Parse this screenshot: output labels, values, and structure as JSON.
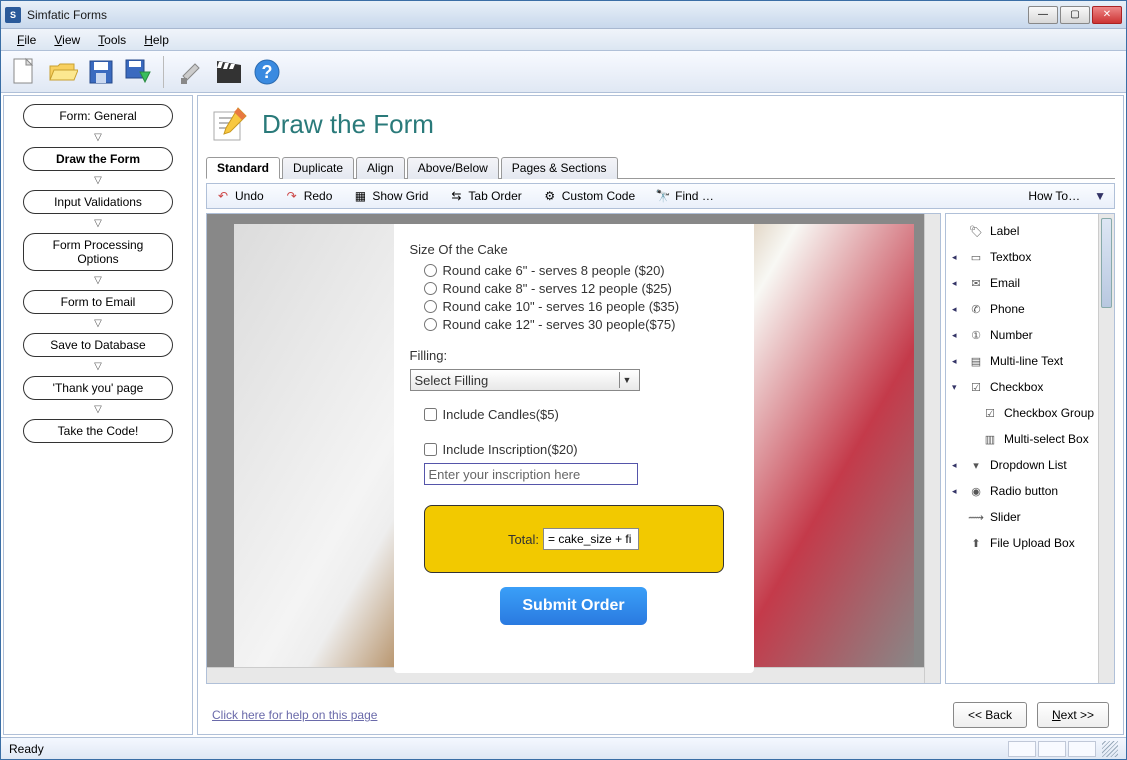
{
  "title": "Simfatic Forms",
  "menu": [
    "File",
    "View",
    "Tools",
    "Help"
  ],
  "page_title": "Draw the Form",
  "steps": [
    {
      "label": "Form: General",
      "active": false
    },
    {
      "label": "Draw the Form",
      "active": true
    },
    {
      "label": "Input Validations",
      "active": false
    },
    {
      "label": "Form Processing Options",
      "active": false
    },
    {
      "label": "Form to Email",
      "active": false
    },
    {
      "label": "Save to Database",
      "active": false
    },
    {
      "label": "'Thank you' page",
      "active": false
    },
    {
      "label": "Take the Code!",
      "active": false
    }
  ],
  "tabs": [
    "Standard",
    "Duplicate",
    "Align",
    "Above/Below",
    "Pages & Sections"
  ],
  "active_tab": "Standard",
  "editor_toolbar": {
    "undo": "Undo",
    "redo": "Redo",
    "show_grid": "Show Grid",
    "tab_order": "Tab Order",
    "custom_code": "Custom Code",
    "find": "Find …",
    "how_to": "How To…"
  },
  "form": {
    "size_label": "Size Of the Cake",
    "sizes": [
      "Round cake 6\" - serves 8 people ($20)",
      "Round cake 8\" - serves 12 people ($25)",
      "Round cake 10\" - serves 16 people ($35)",
      "Round cake 12\" - serves 30 people($75)"
    ],
    "filling_label": "Filling:",
    "filling_selected": "Select Filling",
    "candles_label": "Include Candles($5)",
    "inscription_label": "Include Inscription($20)",
    "inscription_placeholder": "Enter your inscription here",
    "total_label": "Total:",
    "total_value": "= cake_size + fi",
    "submit": "Submit Order"
  },
  "widgets": [
    {
      "name": "Label",
      "tri": false
    },
    {
      "name": "Textbox",
      "tri": true
    },
    {
      "name": "Email",
      "tri": true
    },
    {
      "name": "Phone",
      "tri": true
    },
    {
      "name": "Number",
      "tri": true
    },
    {
      "name": "Multi-line Text",
      "tri": true
    },
    {
      "name": "Checkbox",
      "tri": true,
      "expanded": true
    },
    {
      "name": "Checkbox Group",
      "tri": false,
      "indent": true
    },
    {
      "name": "Multi-select Box",
      "tri": false,
      "indent": true
    },
    {
      "name": "Dropdown List",
      "tri": true
    },
    {
      "name": "Radio button",
      "tri": true
    },
    {
      "name": "Slider",
      "tri": false
    },
    {
      "name": "File Upload Box",
      "tri": false
    }
  ],
  "help_link": "Click here for help on this page",
  "back": "<< Back",
  "next": "Next >>",
  "status": "Ready"
}
